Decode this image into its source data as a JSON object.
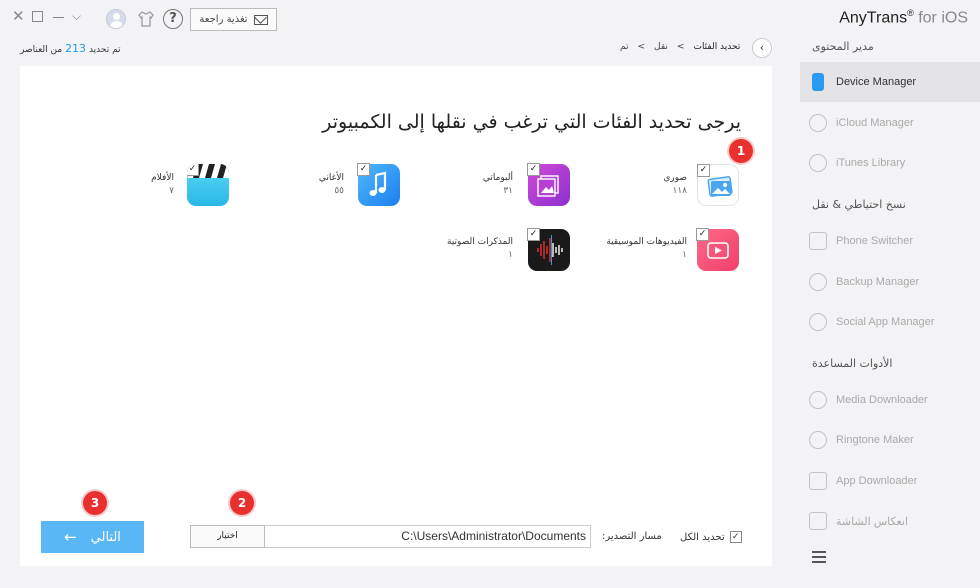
{
  "app": {
    "name": "AnyTrans",
    "suffix": "for iOS",
    "reg": "®"
  },
  "topbar": {
    "feedback_label": "تغذية راجعة",
    "help": "?"
  },
  "header": {
    "count_prefix": "تم تحديد",
    "count_value": "213",
    "count_suffix": "من العناصر",
    "breadcrumb": [
      "تحديد الفئات",
      ">",
      "نقل",
      ">",
      "تم"
    ]
  },
  "main": {
    "title": "يرجى تحديد الفئات التي ترغب في نقلها إلى الكمبيوتر",
    "categories": [
      {
        "label": "صوري",
        "count": "١١٨",
        "checked": true
      },
      {
        "label": "ألبوماتي",
        "count": "٣١",
        "checked": true
      },
      {
        "label": "الأغاني",
        "count": "٥٥",
        "checked": true
      },
      {
        "label": "الأفلام",
        "count": "٧",
        "checked": true
      },
      {
        "label": "الفيديوهات الموسيقية",
        "count": "١",
        "checked": true
      },
      {
        "label": "المذكرات الصوتية",
        "count": "١",
        "checked": true
      }
    ],
    "select_all_label": "تحديد الكل",
    "export_path_label": "مسار التصدير:",
    "export_path_value": "C:\\Users\\Administrator\\Documents",
    "choose_label": "اختيار",
    "next_label": "التالي",
    "badges": [
      "1",
      "2",
      "3"
    ]
  },
  "sidebar": {
    "sections": [
      {
        "title": "مدير المحتوى",
        "items": [
          "Device Manager",
          "iCloud Manager",
          "iTunes Library"
        ]
      },
      {
        "title": "نسخ احتياطي & نقل",
        "items": [
          "Phone Switcher",
          "Backup Manager",
          "Social App Manager"
        ]
      },
      {
        "title": "الأدوات المساعدة",
        "items": [
          "Media Downloader",
          "Ringtone Maker",
          "App Downloader",
          "انعكاس الشاشة"
        ]
      }
    ],
    "active_item": "Device Manager"
  },
  "colors": {
    "accent": "#1e9bf0",
    "next_button": "#5ab7f5",
    "badge": "#e8312f",
    "device_icon": "#2a9af2"
  },
  "icons": [
    "close-icon",
    "maximize-icon",
    "minimize-icon",
    "dropdown-icon",
    "avatar-icon",
    "shirt-icon",
    "help-icon",
    "mail-icon",
    "back-arrow-icon",
    "photos-icon",
    "albums-icon",
    "songs-icon",
    "movies-icon",
    "music-videos-icon",
    "voice-memos-icon",
    "checkbox-icon",
    "arrow-left-icon",
    "menu-icon"
  ]
}
